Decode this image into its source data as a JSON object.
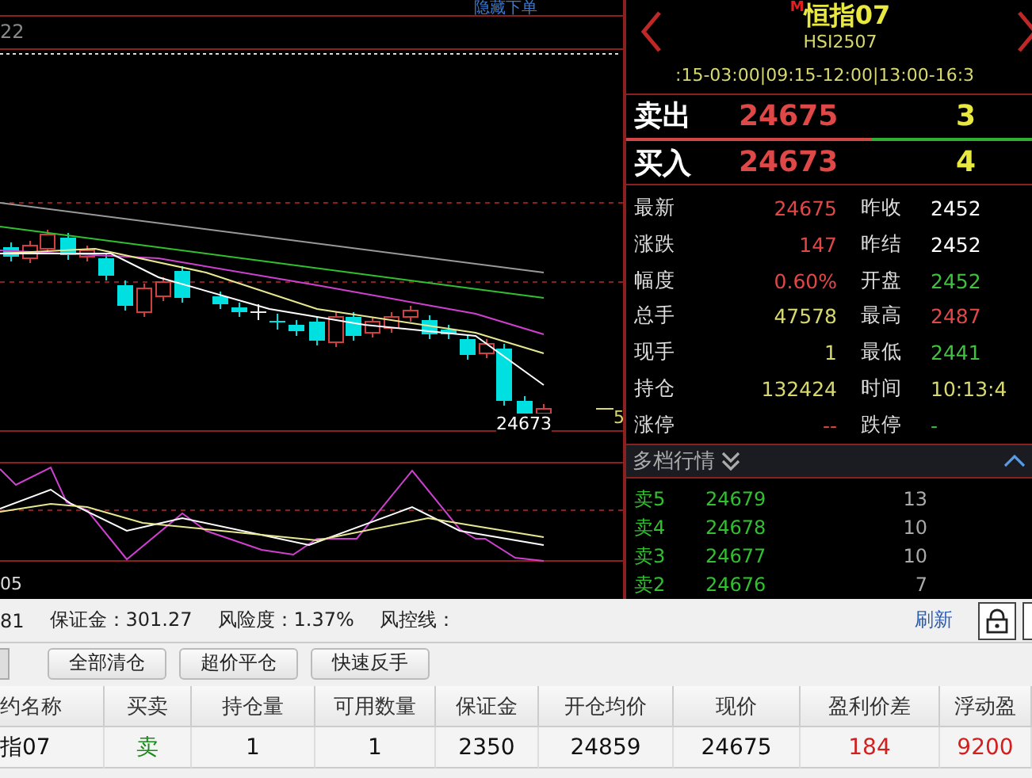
{
  "chart": {
    "hide_order_link": "隐藏下单",
    "period_label": "22",
    "last_price_label": "24673",
    "axis_label": "5",
    "indicator_label": "05"
  },
  "quote": {
    "market_badge": "M",
    "title": "恒指07",
    "code": "HSI2507",
    "sessions": ":15-03:00|09:15-12:00|13:00-16:3",
    "ask": {
      "label": "卖出",
      "price": "24675",
      "volume": "3"
    },
    "bid": {
      "label": "买入",
      "price": "24673",
      "volume": "4"
    },
    "stats": [
      {
        "label": "最新",
        "value": "24675",
        "color": "#e04848"
      },
      {
        "label": "昨收",
        "value": "2452",
        "color": "#ffffff"
      },
      {
        "label": "涨跌",
        "value": "147",
        "color": "#e04848"
      },
      {
        "label": "昨结",
        "value": "2452",
        "color": "#ffffff"
      },
      {
        "label": "幅度",
        "value": "0.60%",
        "color": "#e04848"
      },
      {
        "label": "开盘",
        "value": "2452",
        "color": "#40c040"
      },
      {
        "label": "总手",
        "value": "47578",
        "color": "#d8d870"
      },
      {
        "label": "最高",
        "value": "2487",
        "color": "#e04848"
      },
      {
        "label": "现手",
        "value": "1",
        "color": "#d8d870"
      },
      {
        "label": "最低",
        "value": "2441",
        "color": "#40c040"
      },
      {
        "label": "持仓",
        "value": "132424",
        "color": "#d8d870"
      },
      {
        "label": "时间",
        "value": "10:13:4",
        "color": "#d8d870"
      },
      {
        "label": "涨停",
        "value": "--",
        "color": "#e04848"
      },
      {
        "label": "跌停",
        "value": "-",
        "color": "#40c040"
      }
    ],
    "depth_title": "多档行情",
    "depth": [
      {
        "label": "卖5",
        "price": "24679",
        "volume": "13"
      },
      {
        "label": "卖4",
        "price": "24678",
        "volume": "10"
      },
      {
        "label": "卖3",
        "price": "24677",
        "volume": "10"
      },
      {
        "label": "卖2",
        "price": "24676",
        "volume": "7"
      }
    ]
  },
  "account": {
    "items": [
      "81",
      "保证金：301.27",
      "风险度：1.37%",
      "风控线："
    ],
    "refresh": "刷新"
  },
  "actions": [
    "全部清仓",
    "超价平仓",
    "快速反手"
  ],
  "table": {
    "columns": [
      "约名称",
      "买卖",
      "持仓量",
      "可用数量",
      "保证金",
      "开仓均价",
      "现价",
      "盈利价差",
      "浮动盈"
    ],
    "rows": [
      [
        {
          "text": "指07",
          "color": "#111111"
        },
        {
          "text": "卖",
          "color": "#1a8a1a"
        },
        {
          "text": "1",
          "color": "#111111"
        },
        {
          "text": "1",
          "color": "#111111"
        },
        {
          "text": "2350",
          "color": "#111111"
        },
        {
          "text": "24859",
          "color": "#111111"
        },
        {
          "text": "24675",
          "color": "#111111"
        },
        {
          "text": "184",
          "color": "#d02020"
        },
        {
          "text": "9200",
          "color": "#d02020"
        }
      ]
    ]
  }
}
